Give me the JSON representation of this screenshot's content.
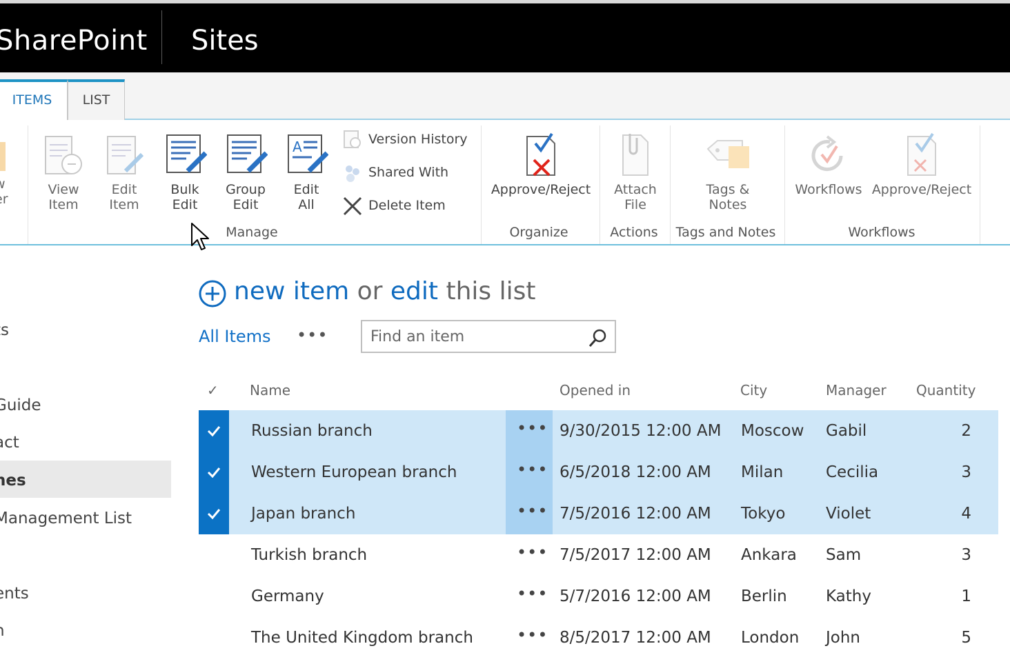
{
  "suitebar": {
    "brand": "SharePoint",
    "sites": "Sites"
  },
  "ribbon": {
    "tabs": [
      {
        "label": "ITEMS"
      },
      {
        "label": "LIST"
      }
    ],
    "partial_button": {
      "line1": "w",
      "line2": "er"
    },
    "manage": {
      "group_label": "Manage",
      "view_item": {
        "line1": "View",
        "line2": "Item"
      },
      "edit_item": {
        "line1": "Edit",
        "line2": "Item"
      },
      "bulk_edit": {
        "line1": "Bulk",
        "line2": "Edit"
      },
      "group_edit": {
        "line1": "Group",
        "line2": "Edit"
      },
      "edit_all": {
        "line1": "Edit",
        "line2": "All"
      },
      "version_history": "Version History",
      "shared_with": "Shared With",
      "delete_item": "Delete Item"
    },
    "organize": {
      "group_label": "Organize",
      "approve_reject": "Approve/Reject"
    },
    "actions": {
      "group_label": "Actions",
      "attach_file": {
        "line1": "Attach",
        "line2": "File"
      }
    },
    "tags": {
      "group_label": "Tags and Notes",
      "tags_notes": {
        "line1": "Tags &",
        "line2": "Notes"
      }
    },
    "workflows": {
      "group_label": "Workflows",
      "workflows": "Workflows",
      "approve_reject": "Approve/Reject"
    }
  },
  "leftnav": {
    "items": [
      "ts",
      "Guide",
      "act",
      "nes",
      "Management List",
      "ents",
      "n"
    ],
    "selected_index": 3
  },
  "main": {
    "new_item": "new item",
    "or": " or ",
    "edit": "edit",
    "this_list": " this list",
    "view_name": "All Items",
    "view_more": "•••",
    "search_placeholder": "Find an item"
  },
  "table": {
    "headers": {
      "check": "✓",
      "name": "Name",
      "opened": "Opened in",
      "city": "City",
      "manager": "Manager",
      "quantity": "Quantity"
    },
    "rows": [
      {
        "name": "Russian branch",
        "opened": "9/30/2015 12:00 AM",
        "city": "Moscow",
        "manager": "Gabil",
        "quantity": "2",
        "selected": true
      },
      {
        "name": "Western European branch",
        "opened": "6/5/2018 12:00 AM",
        "city": "Milan",
        "manager": "Cecilia",
        "quantity": "3",
        "selected": true
      },
      {
        "name": "Japan branch",
        "opened": "7/5/2016 12:00 AM",
        "city": "Tokyo",
        "manager": "Violet",
        "quantity": "4",
        "selected": true
      },
      {
        "name": "Turkish branch",
        "opened": "7/5/2017 12:00 AM",
        "city": "Ankara",
        "manager": "Sam",
        "quantity": "3",
        "selected": false
      },
      {
        "name": "Germany",
        "opened": "5/7/2016 12:00 AM",
        "city": "Berlin",
        "manager": "Kathy",
        "quantity": "1",
        "selected": false
      },
      {
        "name": "The United Kingdom branch",
        "opened": "8/5/2017 12:00 AM",
        "city": "London",
        "manager": "John",
        "quantity": "5",
        "selected": false
      }
    ],
    "row_menu": "•••"
  },
  "colors": {
    "accent": "#0f6bbf",
    "selected_row": "#cfe7f8",
    "selected_check": "#0b72c5"
  }
}
